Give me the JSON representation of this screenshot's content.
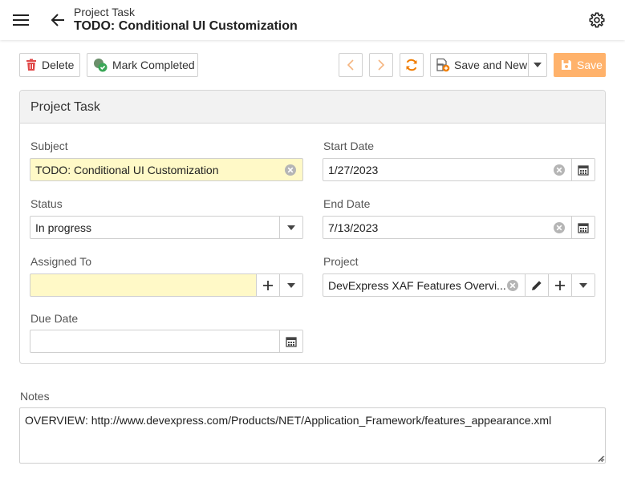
{
  "header": {
    "subtitle": "Project Task",
    "title": "TODO: Conditional UI Customization"
  },
  "toolbar": {
    "delete_label": "Delete",
    "mark_completed_label": "Mark Completed",
    "save_and_new_label": "Save and New",
    "save_label": "Save"
  },
  "panel": {
    "title": "Project Task"
  },
  "form": {
    "subject": {
      "label": "Subject",
      "value": "TODO: Conditional UI Customization"
    },
    "status": {
      "label": "Status",
      "value": "In progress"
    },
    "assigned_to": {
      "label": "Assigned To",
      "value": ""
    },
    "due_date": {
      "label": "Due Date",
      "value": ""
    },
    "start_date": {
      "label": "Start Date",
      "value": "1/27/2023"
    },
    "end_date": {
      "label": "End Date",
      "value": "7/13/2023"
    },
    "project": {
      "label": "Project",
      "value": "DevExpress XAF Features Overvi..."
    }
  },
  "notes": {
    "label": "Notes",
    "value": "OVERVIEW: http://www.devexpress.com/Products/NET/Application_Framework/features_appearance.xml"
  },
  "colors": {
    "accent_orange": "#ffb26b",
    "required_highlight": "#fff9c7",
    "delete_red": "#e04848",
    "complete_green": "#3aa757",
    "refresh_orange": "#f07c00"
  },
  "icons": {
    "menu": "hamburger-icon",
    "back": "arrow-left-icon",
    "settings": "gear-icon",
    "delete": "trash-icon",
    "complete": "check-circle-icon",
    "prev": "chevron-left-icon",
    "next": "chevron-right-icon",
    "refresh": "refresh-icon",
    "save_new": "save-new-icon",
    "save": "save-icon",
    "clear": "clear-circle-icon",
    "calendar": "calendar-icon",
    "dropdown": "caret-down-icon",
    "add": "plus-icon",
    "edit": "pencil-icon"
  }
}
